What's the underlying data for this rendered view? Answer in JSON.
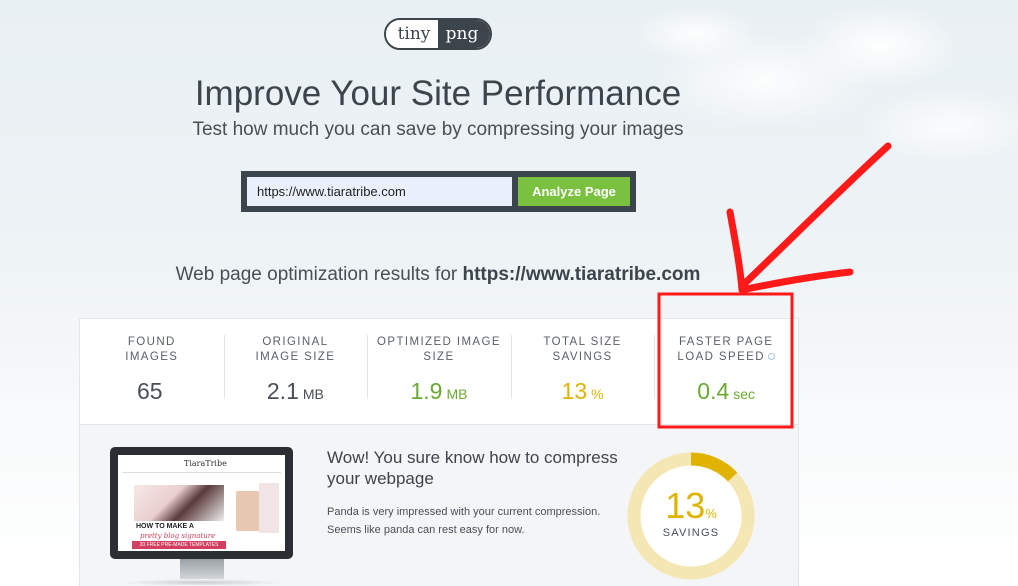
{
  "logo": {
    "left": "tiny",
    "right": "png"
  },
  "hero": {
    "title": "Improve Your Site Performance",
    "subtitle": "Test how much you can save by compressing your images"
  },
  "search": {
    "value": "https://www.tiaratribe.com",
    "button_label": "Analyze Page"
  },
  "results": {
    "prefix": "Web page optimization results for",
    "url": "https://www.tiaratribe.com"
  },
  "stats": [
    {
      "label_l1": "FOUND",
      "label_l2": "IMAGES",
      "value": "65",
      "unit": "",
      "color": "#4a4f55"
    },
    {
      "label_l1": "ORIGINAL",
      "label_l2": "IMAGE SIZE",
      "value": "2.1",
      "unit": "MB",
      "color": "#4a4f55"
    },
    {
      "label_l1": "OPTIMIZED IMAGE",
      "label_l2": "SIZE",
      "value": "1.9",
      "unit": "MB",
      "color": "#6aaa32"
    },
    {
      "label_l1": "TOTAL SIZE",
      "label_l2": "SAVINGS",
      "value": "13",
      "unit": "%",
      "color": "#e0b300"
    },
    {
      "label_l1": "FASTER PAGE",
      "label_l2": "LOAD SPEED",
      "value": "0.4",
      "unit": "sec",
      "color": "#6aaa32"
    }
  ],
  "panel": {
    "heading": "Wow! You sure know how to compress your webpage",
    "body": "Panda is very impressed with your current compression. Seems like panda can rest easy for now.",
    "savings_value": "13",
    "savings_unit": "%",
    "savings_label": "SAVINGS",
    "savings_fraction": 0.13
  },
  "preview": {
    "logo": "TiaraTribe",
    "line1": "HOW TO MAKE A",
    "line2": "pretty blog signature",
    "line3": "20 FREE PRE-MADE TEMPLATES"
  },
  "colors": {
    "accent_green": "#79c13f",
    "dark": "#3d454c",
    "savings_yellow": "#e0b300",
    "annotation_red": "#ff1a1a"
  }
}
